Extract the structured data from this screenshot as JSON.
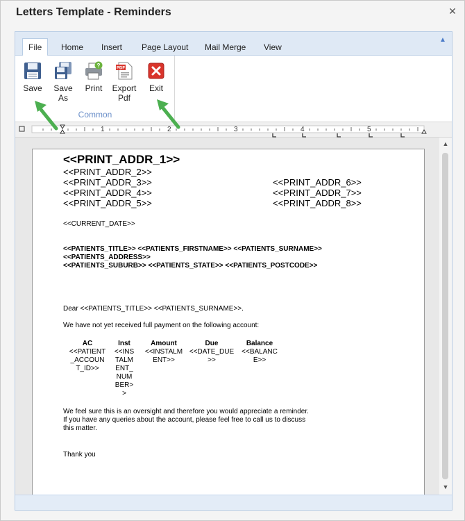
{
  "window": {
    "title": "Letters Template - Reminders"
  },
  "ribbon": {
    "tabs": [
      "File",
      "Home",
      "Insert",
      "Page Layout",
      "Mail Merge",
      "View"
    ],
    "active_tab": "File",
    "group_label": "Common",
    "buttons": [
      {
        "line1": "Save",
        "line2": "",
        "icon": "save-icon"
      },
      {
        "line1": "Save",
        "line2": "As",
        "icon": "save-as-icon"
      },
      {
        "line1": "Print",
        "line2": "",
        "icon": "print-icon"
      },
      {
        "line1": "Export",
        "line2": "Pdf",
        "icon": "export-pdf-icon"
      },
      {
        "line1": "Exit",
        "line2": "",
        "icon": "exit-icon"
      }
    ]
  },
  "ruler": {
    "numbers": [
      "1",
      "2",
      "3",
      "4",
      "5"
    ]
  },
  "letter": {
    "addr1": "<<PRINT_ADDR_1>>",
    "addr2": "<<PRINT_ADDR_2>>",
    "addr3": "<<PRINT_ADDR_3>>",
    "addr4": "<<PRINT_ADDR_4>>",
    "addr5": "<<PRINT_ADDR_5>>",
    "addr6": "<<PRINT_ADDR_6>>",
    "addr7": "<<PRINT_ADDR_7>>",
    "addr8": "<<PRINT_ADDR_8>>",
    "current_date": "<<CURRENT_DATE>>",
    "patient_line1": "<<PATIENTS_TITLE>> <<PATIENTS_FIRSTNAME>> <<PATIENTS_SURNAME>>",
    "patient_line2": "<<PATIENTS_ADDRESS>>",
    "patient_line3": "<<PATIENTS_SUBURB>> <<PATIENTS_STATE>> <<PATIENTS_POSTCODE>>",
    "salutation": "Dear <<PATIENTS_TITLE>> <<PATIENTS_SURNAME>>.",
    "intro": "We have not yet received full payment on the following account:",
    "table": {
      "headers": [
        "AC",
        "Inst",
        "Amount",
        "Due",
        "Balance"
      ],
      "cells": [
        [
          "<<PATIENT",
          "_ACCOUN",
          "T_ID>>"
        ],
        [
          "<<INS",
          "TALM",
          "ENT_",
          "NUM",
          "BER>",
          ">"
        ],
        [
          "<<INSTALM",
          "ENT>>"
        ],
        [
          "<<DATE_DUE",
          ">>"
        ],
        [
          "<<BALANC",
          "E>>"
        ]
      ]
    },
    "closing_1": "We feel sure this is an oversight and therefore you would appreciate a reminder.",
    "closing_2": "If you have any queries about the account, please feel free to call us to discuss",
    "closing_3": "this matter.",
    "signoff": "Thank you"
  },
  "colors": {
    "accent": "#4a7bc8",
    "arrow": "#4caf50",
    "exit_red": "#d9342b"
  }
}
